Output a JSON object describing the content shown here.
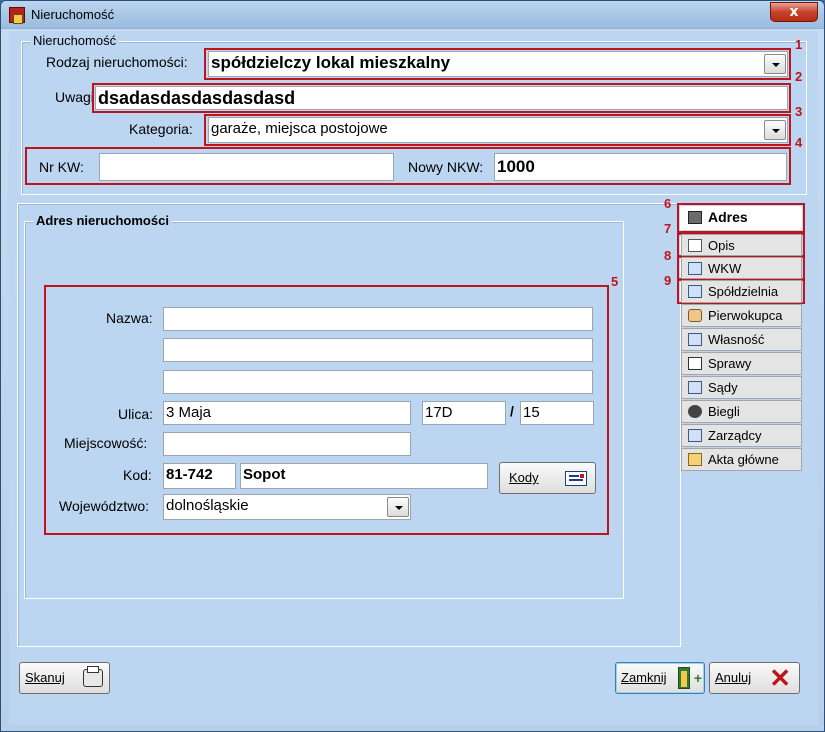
{
  "window": {
    "title": "Nieruchomość",
    "close_glyph": "x"
  },
  "top_group": {
    "legend": "Nieruchomość",
    "rodzaj_label": "Rodzaj nieruchomości:",
    "rodzaj_value": "spółdzielczy lokal mieszkalny",
    "uwagi_label": "Uwagi:",
    "uwagi_value": "dsadasdasdasdasdasd",
    "kategoria_label": "Kategoria:",
    "kategoria_value": "garaże, miejsca postojowe",
    "nrkw_label": "Nr KW:",
    "nrkw_value": "",
    "nowy_nkw_label": "Nowy NKW:",
    "nowy_nkw_value": "1000"
  },
  "annotations": [
    "1",
    "2",
    "3",
    "4",
    "5",
    "6",
    "7",
    "8",
    "9"
  ],
  "address": {
    "legend": "Adres nieruchomości",
    "nazwa_label": "Nazwa:",
    "nazwa_lines": [
      "",
      "",
      ""
    ],
    "ulica_label": "Ulica:",
    "ulica_value": "3 Maja",
    "house_no": "17D",
    "separator": "/",
    "flat_no": "15",
    "miejscowosc_label": "Miejscowość:",
    "miejscowosc_value": "",
    "kod_label": "Kod:",
    "kod_value": "81-742",
    "city_value": "Sopot",
    "kody_button": "Kody",
    "wojewodztwo_label": "Województwo:",
    "wojewodztwo_value": "dolnośląskie"
  },
  "tabs": [
    {
      "label": "Adres",
      "icon": "bank-icon",
      "active": true
    },
    {
      "label": "Opis",
      "icon": "notes-icon"
    },
    {
      "label": "WKW",
      "icon": "book-icon"
    },
    {
      "label": "Spółdzielnia",
      "icon": "book-icon"
    },
    {
      "label": "Pierwokupca",
      "icon": "hand-icon"
    },
    {
      "label": "Własność",
      "icon": "certificate-icon"
    },
    {
      "label": "Sprawy",
      "icon": "case-icon"
    },
    {
      "label": "Sądy",
      "icon": "book-icon"
    },
    {
      "label": "Biegli",
      "icon": "person-icon"
    },
    {
      "label": "Zarządcy",
      "icon": "certificate-icon"
    },
    {
      "label": "Akta główne",
      "icon": "folder-icon"
    }
  ],
  "buttons": {
    "skanuj": "Skanuj",
    "zamknij": "Zamknij",
    "anuluj": "Anuluj"
  },
  "colors": {
    "annotation_red": "#c0141c",
    "window_bg": "#bcd5f0"
  }
}
